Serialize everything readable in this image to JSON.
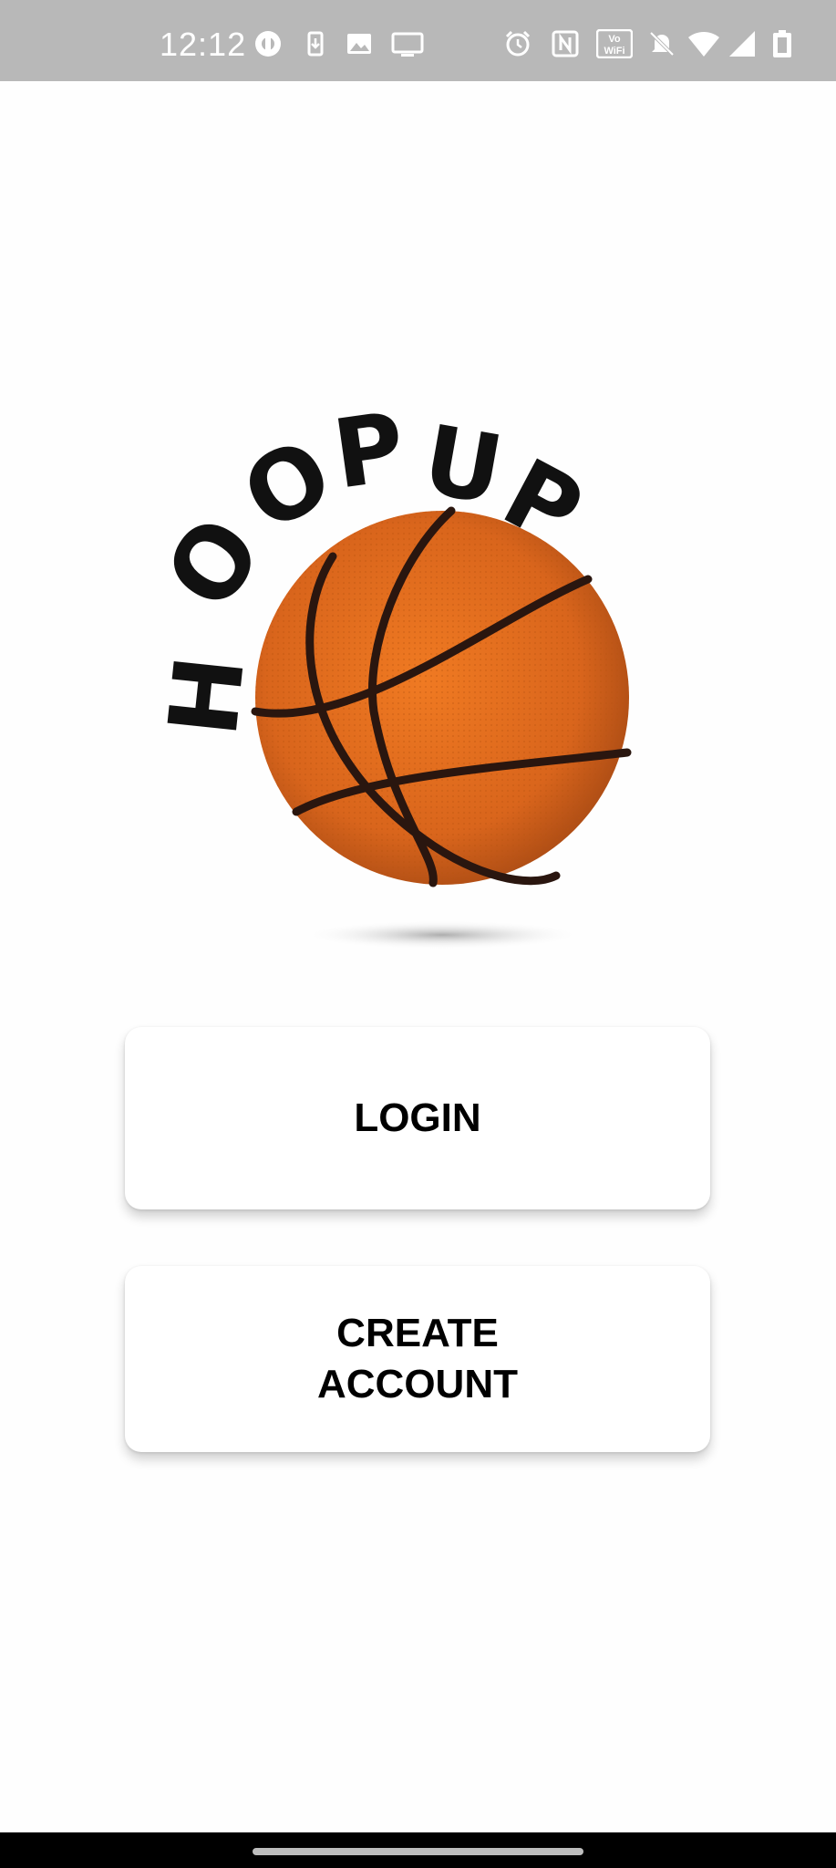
{
  "status_bar": {
    "time": "12:12",
    "left_icons": [
      "whatsapp-icon",
      "sim-download-icon",
      "gallery-icon",
      "cast-icon"
    ],
    "right_icons": [
      "alarm-icon",
      "nfc-icon",
      "vowifi-icon",
      "silent-icon",
      "wifi-icon",
      "signal-icon",
      "battery-icon"
    ],
    "vowifi_label": "Vo WiFi"
  },
  "logo": {
    "text": "HOOPUP",
    "ball_color": "#e06a1f",
    "seam_color": "#2a160f"
  },
  "buttons": {
    "login_label": "LOGIN",
    "create_account_label": "CREATE ACCOUNT"
  },
  "colors": {
    "status_bar": "#b8b8b8",
    "background": "#fefefe",
    "button_bg": "#ffffff",
    "button_text": "#000000",
    "nav_bar": "#000000"
  }
}
